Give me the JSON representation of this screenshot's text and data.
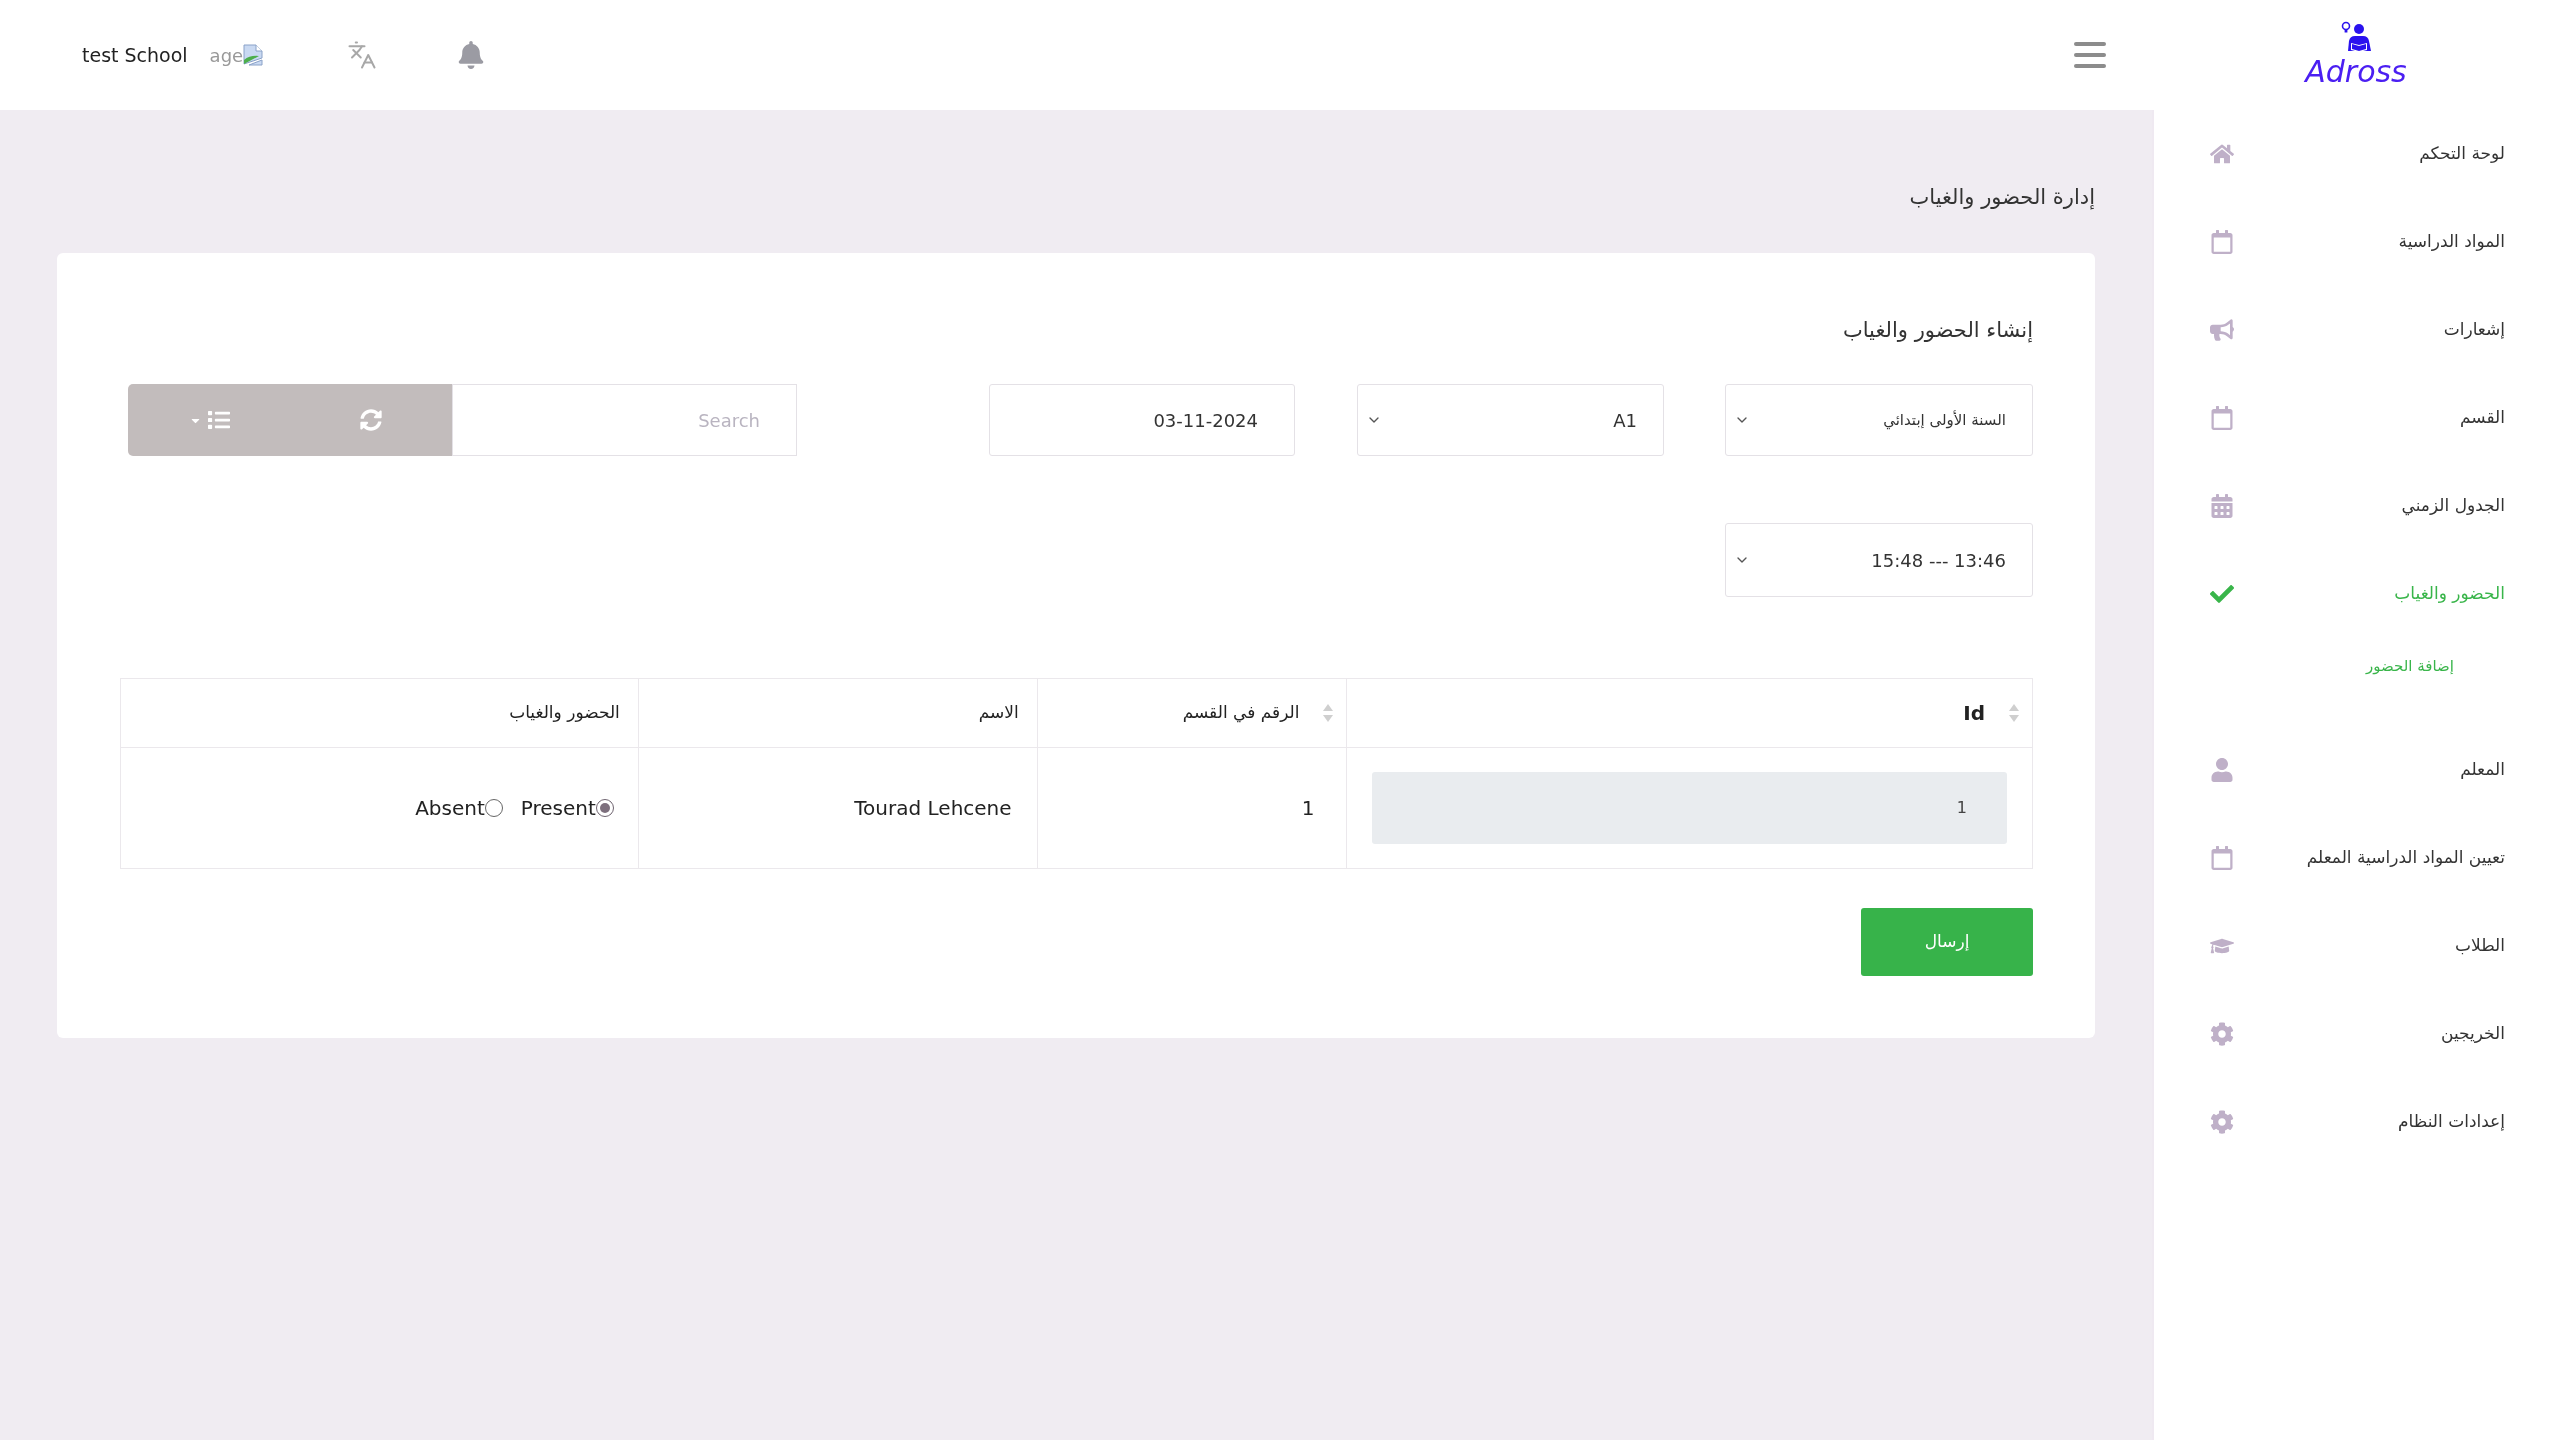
{
  "top_bar": {
    "school_name": "test School",
    "image_alt": "age"
  },
  "sidebar": {
    "logo_text": "Adross",
    "items": [
      {
        "label": "لوحة التحكم",
        "selected": false
      },
      {
        "label": "المواد الدراسية",
        "selected": false
      },
      {
        "label": "إشعارات",
        "selected": false
      },
      {
        "label": "القسم",
        "selected": false
      },
      {
        "label": "الجدول الزمني",
        "selected": false
      },
      {
        "label": "الحضور والغياب",
        "selected": true,
        "children": [
          {
            "label": "إضافة الحضور",
            "selected": true
          }
        ]
      },
      {
        "label": "المعلم",
        "selected": false
      },
      {
        "label": "تعيين المواد الدراسية المعلم",
        "selected": false
      },
      {
        "label": "الطلاب",
        "selected": false
      },
      {
        "label": "الخريجين",
        "selected": false
      },
      {
        "label": "إعدادات النظام",
        "selected": false
      }
    ]
  },
  "page_title": "إدارة الحضور والغياب",
  "form": {
    "title": "إنشاء الحضور والغياب",
    "grade_select": {
      "value": "السنة الأولى إبتدائي"
    },
    "class_select": {
      "value": "A1"
    },
    "date_field": {
      "value": "03-11-2024"
    },
    "search": {
      "placeholder": "Search"
    },
    "time_select": {
      "value": "15:48 --- 13:46"
    }
  },
  "table": {
    "columns": [
      {
        "label": "Id",
        "sortable": true
      },
      {
        "label": "الرقم في القسم",
        "sortable": true
      },
      {
        "label": "الاسم",
        "sortable": false
      },
      {
        "label": "الحضور والغياب",
        "sortable": false
      }
    ],
    "rows": [
      {
        "id": "1",
        "number": "1",
        "name": "Tourad Lehcene",
        "attendance": [
          {
            "label": "Present",
            "selected": true
          },
          {
            "label": "Absent",
            "selected": false
          }
        ]
      }
    ]
  },
  "submit_button": {
    "label": "إرسال"
  }
}
